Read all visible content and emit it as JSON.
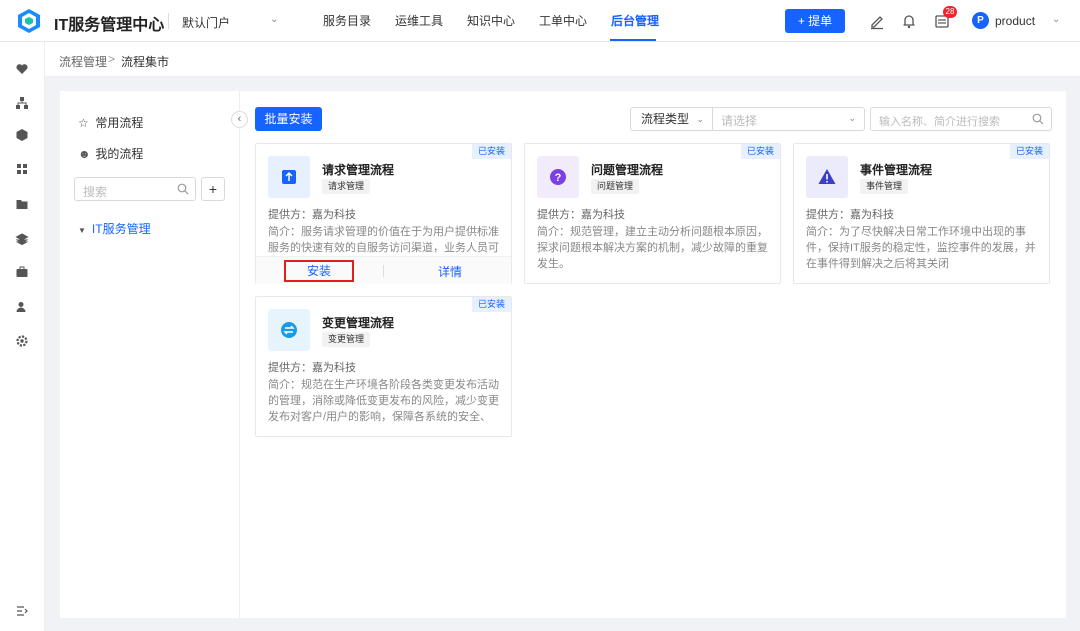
{
  "app": {
    "title": "IT服务管理中心",
    "portal": "默认门户",
    "brand_color": "#1663ff"
  },
  "nav": {
    "items": [
      "服务目录",
      "运维工具",
      "知识中心",
      "工单中心",
      "后台管理"
    ],
    "active": "后台管理"
  },
  "header": {
    "submit_label": "+ 提单",
    "badge_count": "28",
    "avatar_letter": "P",
    "username": "product"
  },
  "breadcrumb": {
    "parent": "流程管理",
    "separator": ">",
    "current": "流程集市"
  },
  "left_panel": {
    "common": "常用流程",
    "mine": "我的流程",
    "search_placeholder": "搜索",
    "add": "+",
    "tree_item": "IT服务管理"
  },
  "toolbar": {
    "batch_install": "批量安装",
    "filter_label": "流程类型",
    "filter_placeholder": "请选择",
    "search_placeholder": "输入名称、简介进行搜索"
  },
  "cards": [
    {
      "status": "已安装",
      "title": "请求管理流程",
      "tag": "请求管理",
      "provider": "提供方：嘉为科技",
      "desc": "简介：服务请求管理的价值在于为用户提供标准服务的快速有效的自服务访问渠道，业务人员可以通",
      "install": "安装",
      "detail": "详情",
      "icon": "upload-icon"
    },
    {
      "status": "已安装",
      "title": "问题管理流程",
      "tag": "问题管理",
      "provider": "提供方：嘉为科技",
      "desc": "简介：规范管理，建立主动分析问题根本原因，探求问题根本解决方案的机制，减少故障的重复发生。",
      "icon": "question-icon"
    },
    {
      "status": "已安装",
      "title": "事件管理流程",
      "tag": "事件管理",
      "provider": "提供方：嘉为科技",
      "desc": "简介：为了尽快解决日常工作环境中出现的事件，保持IT服务的稳定性，监控事件的发展，并在事件得到解决之后将其关闭",
      "icon": "warning-icon"
    },
    {
      "status": "已安装",
      "title": "变更管理流程",
      "tag": "变更管理",
      "provider": "提供方：嘉为科技",
      "desc": "简介：规范在生产环境各阶段各类变更发布活动的管理，消除或降低变更发布的风险，减少变更发布对客户/用户的影响，保障各系统的安全、稳定…",
      "icon": "swap-icon"
    }
  ]
}
